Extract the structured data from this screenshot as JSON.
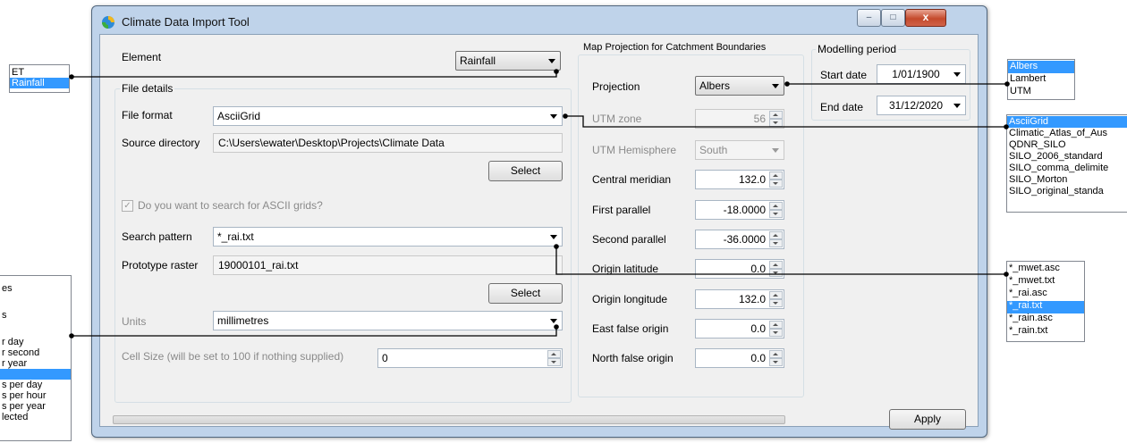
{
  "window": {
    "title": "Climate Data Import Tool",
    "caption": {
      "minimize": "–",
      "maximize": "□",
      "close": "x"
    }
  },
  "element": {
    "label": "Element",
    "value": "Rainfall"
  },
  "file_details": {
    "title": "File details",
    "file_format_label": "File format",
    "file_format_value": "AsciiGrid",
    "source_dir_label": "Source directory",
    "source_dir_value": "C:\\Users\\ewater\\Desktop\\Projects\\Climate Data",
    "select_label": "Select",
    "search_ascii_label": "Do you want to search for ASCII grids?",
    "search_ascii_checked": true,
    "search_pattern_label": "Search pattern",
    "search_pattern_value": "*_rai.txt",
    "prototype_label": "Prototype raster",
    "prototype_value": "19000101_rai.txt",
    "select2_label": "Select",
    "units_label": "Units",
    "units_value": "millimetres",
    "cell_size_label": "Cell Size (will be set to 100 if nothing supplied)",
    "cell_size_value": "0"
  },
  "projection": {
    "title": "Map Projection for Catchment Boundaries",
    "projection_label": "Projection",
    "projection_value": "Albers",
    "utm_zone_label": "UTM zone",
    "utm_zone_value": "56",
    "utm_hemi_label": "UTM Hemisphere",
    "utm_hemi_value": "South",
    "fields": [
      {
        "label": "Central meridian",
        "value": "132.0"
      },
      {
        "label": "First parallel",
        "value": "-18.0000"
      },
      {
        "label": "Second parallel",
        "value": "-36.0000"
      },
      {
        "label": "Origin latitude",
        "value": "0.0"
      },
      {
        "label": "Origin longitude",
        "value": "132.0"
      },
      {
        "label": "East false origin",
        "value": "0.0"
      },
      {
        "label": "North false origin",
        "value": "0.0"
      }
    ]
  },
  "modelling": {
    "title": "Modelling period",
    "start_label": "Start date",
    "start_value": "1/01/1900",
    "end_label": "End date",
    "end_value": "31/12/2020"
  },
  "apply_label": "Apply",
  "progress_fraction": 0,
  "lists": {
    "element_options": [
      "ET",
      "Rainfall"
    ],
    "element_selected": 1,
    "projection_options": [
      "Albers",
      "Lambert",
      "UTM"
    ],
    "projection_selected": 0,
    "format_options": [
      "AsciiGrid",
      "Climatic_Atlas_of_Aus",
      "QDNR_SILO",
      "SILO_2006_standard",
      "SILO_comma_delimite",
      "SILO_Morton",
      "SILO_original_standa"
    ],
    "format_selected": 0,
    "pattern_options": [
      "*_mwet.asc",
      "*_mwet.txt",
      "*_rai.asc",
      "*_rai.txt",
      "*_rain.asc",
      "*_rain.txt"
    ],
    "pattern_selected": 3,
    "units_options": [
      "es",
      "",
      "s",
      "",
      "r day",
      "r second",
      "r year",
      "",
      "s per day",
      "s per hour",
      "s per year",
      "lected"
    ],
    "units_selected": 7
  },
  "colors": {
    "selection": "#3399ff",
    "window_frame": "#bfd3ea",
    "client_bg": "#f0f0f0"
  }
}
